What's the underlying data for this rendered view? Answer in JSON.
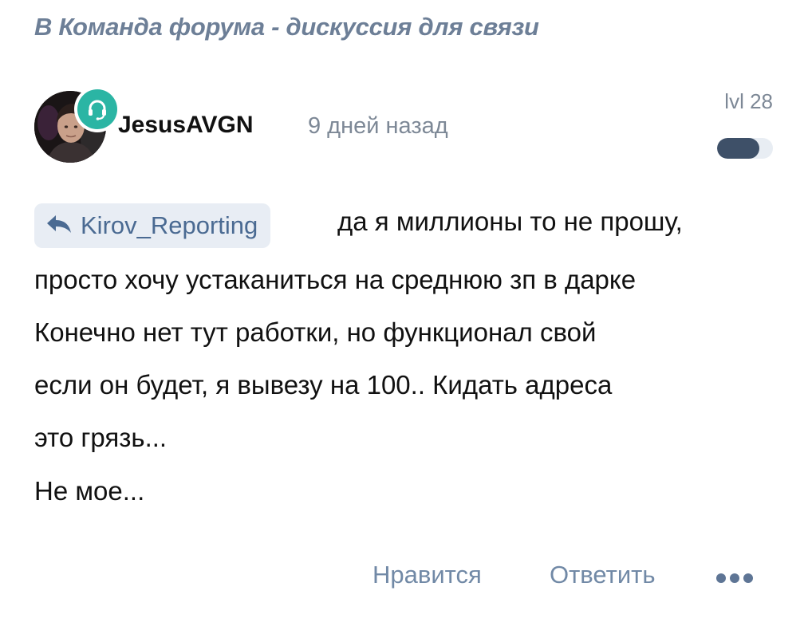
{
  "breadcrumb": {
    "text": "В Команда форума - дискуссия для связи"
  },
  "post": {
    "author": "JesusAVGN",
    "time": "9 дней назад",
    "level_label": "lvl 28",
    "level_progress": 0.75,
    "badge_icon": "headset-icon",
    "reply_to": "Kirov_Reporting",
    "reply_icon": "reply-arrow-icon",
    "lines": [
      "да я миллионы то не прошу,",
      "просто хочу устаканиться на среднюю зп в дарке",
      "Конечно нет тут работки, но функционал свой",
      "если он будет, я вывезу на 100.. Кидать адреса",
      "это грязь...",
      "Не мое..."
    ]
  },
  "actions": {
    "like": "Нравится",
    "reply": "Ответить",
    "more_icon": "more-dots-icon"
  },
  "colors": {
    "breadcrumb": "#6d7f97",
    "muted": "#7d8896",
    "badge": "#2bb5a4",
    "chip_bg": "#e8edf4",
    "chip_text": "#4a6a92",
    "action": "#7189a6",
    "level_fill": "#3e5068"
  }
}
